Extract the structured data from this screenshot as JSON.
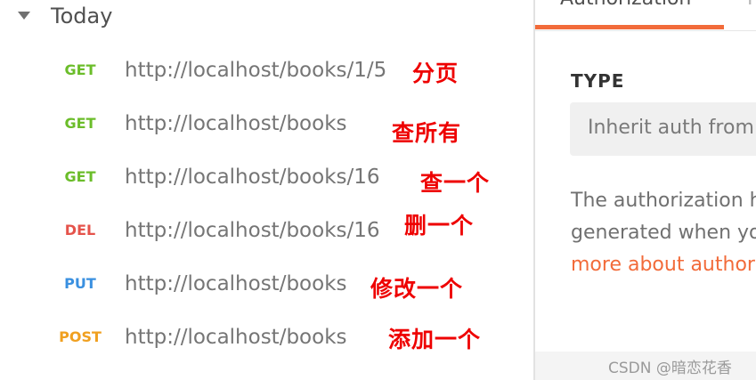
{
  "history": {
    "group_label": "Today",
    "requests": [
      {
        "method": "GET",
        "color": "#6bbd2a",
        "url": "http://localhost/books/1/5",
        "note": "分页"
      },
      {
        "method": "GET",
        "color": "#6bbd2a",
        "url": "http://localhost/books",
        "note": "查所有"
      },
      {
        "method": "GET",
        "color": "#6bbd2a",
        "url": "http://localhost/books/16",
        "note": "查一个"
      },
      {
        "method": "DEL",
        "color": "#e5534b",
        "url": "http://localhost/books/16",
        "note": "删一个"
      },
      {
        "method": "PUT",
        "color": "#3a90e0",
        "url": "http://localhost/books",
        "note": "修改一个"
      },
      {
        "method": "POST",
        "color": "#f0a020",
        "url": "http://localhost/books",
        "note": "添加一个"
      }
    ]
  },
  "auth_panel": {
    "active_tab": "Authorization",
    "next_tab": "H",
    "type_label": "TYPE",
    "type_value": "Inherit auth from parent",
    "description_line1": "The authorization header will be automatically",
    "description_line2": "generated when you send the request. Learn",
    "learn_more": "more about authorization"
  },
  "accent_color": "#f26b3a",
  "annotation_color": "#ee0000",
  "watermark": "CSDN @暗恋花香"
}
